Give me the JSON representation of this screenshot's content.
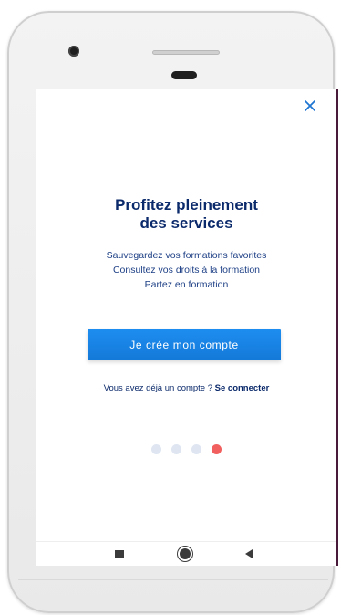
{
  "onboarding": {
    "title_line1": "Profitez pleinement",
    "title_line2": "des services",
    "benefits": [
      "Sauvegardez vos formations favorites",
      "Consultez vos droits à la formation",
      "Partez en formation"
    ],
    "create_account_label": "Je crée mon compte",
    "already_account_text": "Vous avez déjà un compte ?",
    "login_label": "Se connecter",
    "pager": {
      "total": 4,
      "active": 4
    }
  },
  "icons": {
    "close": "close-icon",
    "nav_recents": "recents-square-icon",
    "nav_home": "home-circle-icon",
    "nav_back": "back-triangle-icon"
  },
  "colors": {
    "title": "#0b2a6b",
    "cta_background": "#1d8df0",
    "dot_inactive": "#dfe6f1",
    "dot_active": "#f1605e"
  }
}
